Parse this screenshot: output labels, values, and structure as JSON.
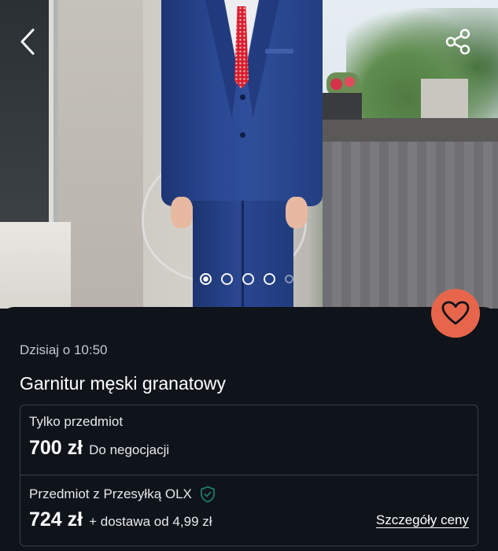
{
  "listing": {
    "date": "Dzisiaj o 10:50",
    "title": "Garnitur męski granatowy"
  },
  "gallery": {
    "total_images": 5,
    "active_index": 0
  },
  "pricing": {
    "item_only": {
      "label": "Tylko przedmiot",
      "price": "700 zł",
      "note": "Do negocjacji"
    },
    "with_shipping": {
      "label": "Przedmiot z Przesyłką OLX",
      "price": "724 zł",
      "note": "+ dostawa od 4,99 zł",
      "details_link": "Szczegóły ceny"
    }
  },
  "icons": {
    "back": "chevron-left-icon",
    "share": "share-icon",
    "favorite": "heart-icon",
    "protection": "shield-check-icon"
  },
  "colors": {
    "panel_bg": "#0f131a",
    "favorite_bg": "#e7664b",
    "shield": "#1f7a6a"
  }
}
